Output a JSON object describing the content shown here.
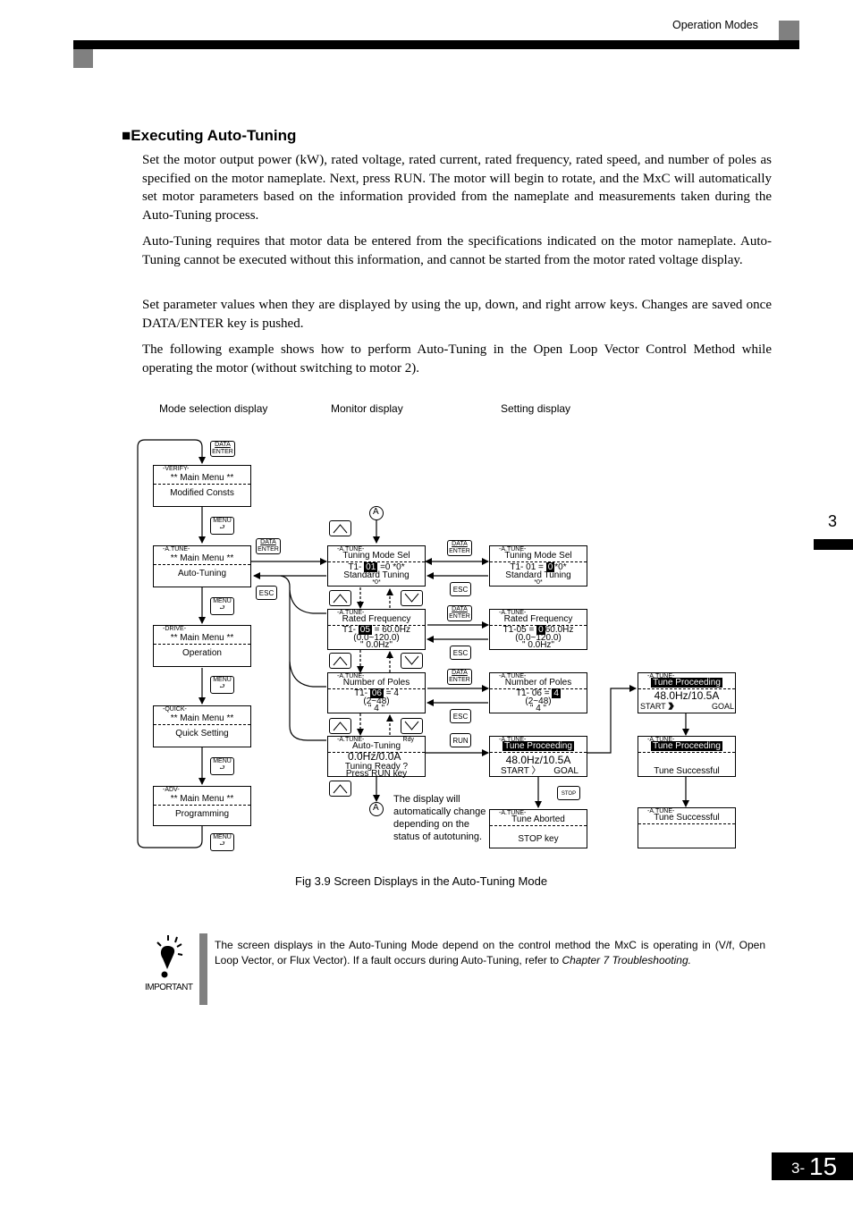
{
  "header": {
    "section_title": "Operation Modes"
  },
  "chapter_tab": "3",
  "page_number": {
    "chapter": "3-",
    "page": "15"
  },
  "section": {
    "bullet": "■",
    "heading": "Executing Auto-Tuning",
    "paragraphs": [
      "Set the motor output power (kW), rated voltage, rated current, rated frequency, rated speed, and number of poles as specified on the motor nameplate. Next, press RUN. The motor will begin to rotate, and the MxC will automatically set motor parameters based on the information provided from the nameplate and measurements taken during the Auto-Tuning process.",
      "Auto-Tuning requires that motor data be entered from the specifications indicated on the motor nameplate. Auto-Tuning cannot be executed without this information, and cannot be started from the motor rated voltage display.",
      "Set parameter values when they are displayed by using the up, down, and right arrow keys. Changes are saved once DATA/ENTER key is pushed.",
      "The following example shows how to perform Auto-Tuning in the Open Loop Vector Control Method while operating the motor (without switching to motor 2)."
    ]
  },
  "figure": {
    "column_headers": [
      "Mode selection display",
      "Monitor display",
      "Setting display"
    ],
    "caption": "Fig 3.9  Screen Displays in the Auto-Tuning Mode",
    "mode_screens": [
      {
        "tag": "-VERIFY-",
        "title": "** Main Menu **",
        "body": "Modified Consts"
      },
      {
        "tag": "-A.TUNE-",
        "title": "** Main Menu **",
        "body": "Auto-Tuning"
      },
      {
        "tag": "-DRIVE-",
        "title": "** Main Menu **",
        "body": "Operation"
      },
      {
        "tag": "-QUICK-",
        "title": "** Main Menu **",
        "body": "Quick Setting"
      },
      {
        "tag": "-ADV-",
        "title": "** Main Menu **",
        "body": "Programming"
      }
    ],
    "monitor_screens": [
      {
        "tag": "-A.TUNE-",
        "title": "Tuning Mode Sel",
        "line_pre": "T1- ",
        "line_hl": "01",
        "line_post": " =0 *0*",
        "line2": "Standard Tuning",
        "line3": "*0*"
      },
      {
        "tag": "-A.TUNE-",
        "title": "Rated Frequency",
        "line_pre": "T1- ",
        "line_hl": "05",
        "line_post": " = 60.0Hz",
        "line2": "(0.0~120.0)",
        "line3": "\" 0.0Hz\""
      },
      {
        "tag": "-A.TUNE-",
        "title": "Number of Poles",
        "line_pre": "T1- ",
        "line_hl": "06",
        "line_post": " = 4",
        "line2": "(2~48)",
        "line3": "\" 4 \""
      },
      {
        "tag": "-A.TUNE-",
        "status": "Rdy",
        "title": "Auto-Tuning",
        "value": "0.0Hz/0.0A",
        "line2": "Tuning Ready ?",
        "line3": "Press RUN key"
      }
    ],
    "setting_screens": [
      {
        "tag": "-A.TUNE-",
        "title": "Tuning Mode Sel",
        "line_pre": "T1- 01 = ",
        "line_hl": "0",
        "line_post": "*0*",
        "line2": "Standard Tuning",
        "line3": "*0*"
      },
      {
        "tag": "-A.TUNE-",
        "title": "Rated Frequency",
        "line_pre": "T1-05 = ",
        "line_hl": "0",
        "line_post": "60.0Hz",
        "line2": "(0.0~120.0)",
        "line3": "\" 0.0Hz\""
      },
      {
        "tag": "-A.TUNE-",
        "title": "Number of Poles",
        "line_pre": "T1- 06 = ",
        "line_hl": "4",
        "line_post": "",
        "line2": "(2~48)",
        "line3": "\" 4 \""
      },
      {
        "tag": "-A.TUNE-",
        "title": "Tune Proceeding",
        "value": "48.0Hz/10.5A",
        "progress_start": "START",
        "progress_arrows": "〉",
        "progress_goal": "GOAL"
      },
      {
        "tag": "-A.TUNE-",
        "title": "Tune Aborted",
        "body": "STOP key"
      }
    ],
    "result_screens": [
      {
        "tag": "-A.TUNE-",
        "title": "Tune Proceeding",
        "value": "48.0Hz/10.5A",
        "progress_start": "START",
        "progress_arrows": "〉〉〉〉〉〉〉",
        "progress_goal": "GOAL"
      },
      {
        "tag": "-A.TUNE-",
        "title": "Tune Proceeding",
        "body": "Tune Successful"
      },
      {
        "tag": "-A.TUNE-",
        "title": "Tune Successful",
        "body": ""
      }
    ],
    "keys": {
      "data_top": "DATA",
      "data_bottom": "ENTER",
      "menu": "MENU",
      "esc": "ESC",
      "run": "RUN",
      "stop": "STOP"
    },
    "connector_label": "A",
    "note": "The display will automatically change depending on the status of autotuning."
  },
  "important": {
    "label": "IMPORTANT",
    "text_plain": "The screen displays in the Auto-Tuning Mode depend on the control method the MxC is operating in (V/f, Open Loop Vector, or Flux Vector). If a fault occurs during Auto-Tuning, refer to ",
    "text_italic": "Chapter 7 Troubleshooting."
  }
}
